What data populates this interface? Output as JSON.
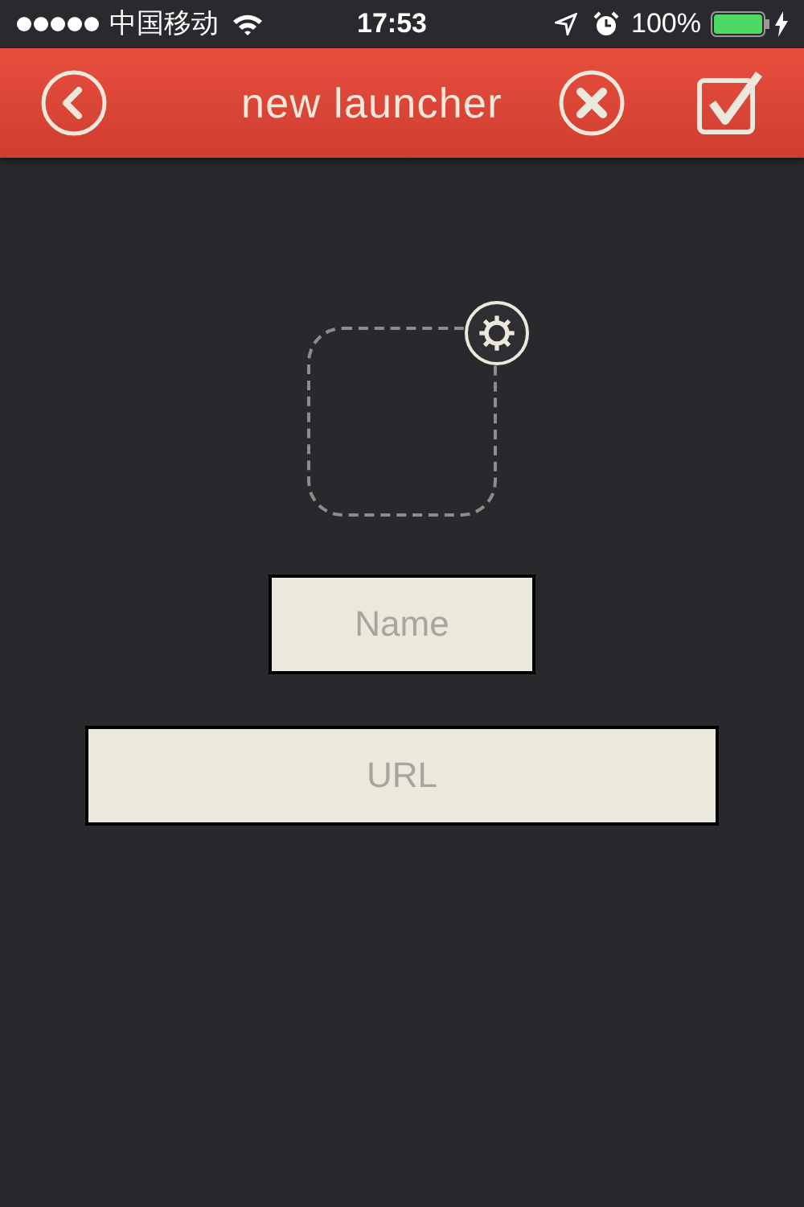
{
  "status_bar": {
    "carrier": "中国移动",
    "time": "17:53",
    "battery": "100%"
  },
  "header": {
    "title": "new launcher"
  },
  "fields": [
    {
      "kind": "short",
      "placeholder": "Name"
    },
    {
      "kind": "wide",
      "placeholder": "URL"
    }
  ]
}
